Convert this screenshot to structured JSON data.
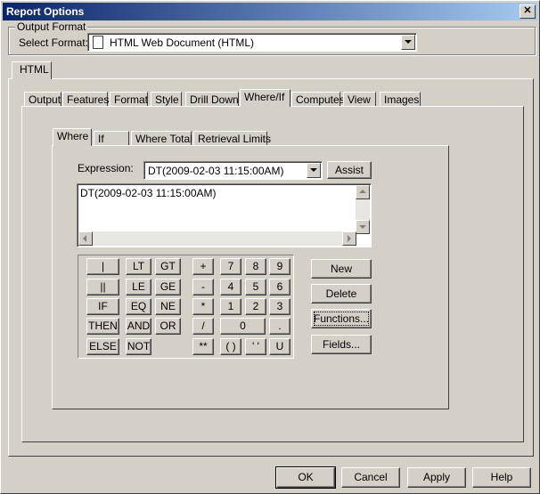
{
  "window": {
    "title": "Report Options",
    "close_glyph": "✕"
  },
  "output_format": {
    "group_label": "Output Format",
    "select_label": "Select Format:",
    "selected": "HTML Web Document (HTML)",
    "icon": "document-icon"
  },
  "outer_tab": "HTML",
  "tabs": [
    "Output",
    "Features",
    "Format",
    "Style",
    "Drill Down",
    "Where/If",
    "Computes",
    "View",
    "Images"
  ],
  "selected_tab": "Where/If",
  "subtabs": [
    "Where",
    "If",
    "Where Total",
    "Retrieval Limits"
  ],
  "selected_subtab": "Where",
  "expression": {
    "label": "Expression:",
    "combo_value": "DT(2009-02-03 11:15:00AM)",
    "assist_label": "Assist",
    "text": "DT(2009-02-03 11:15:00AM)"
  },
  "keys": {
    "k_or": "|",
    "k_concat": "||",
    "k_if": "IF",
    "k_then": "THEN",
    "k_else": "ELSE",
    "k_lt": "LT",
    "k_gt": "GT",
    "k_le": "LE",
    "k_ge": "GE",
    "k_eq": "EQ",
    "k_ne": "NE",
    "k_and": "AND",
    "k_or2": "OR",
    "k_not": "NOT",
    "k_plus": "+",
    "k_minus": "-",
    "k_mul": "*",
    "k_div": "/",
    "k_pow": "**",
    "k7": "7",
    "k8": "8",
    "k9": "9",
    "k4": "4",
    "k5": "5",
    "k6": "6",
    "k1": "1",
    "k2": "2",
    "k3": "3",
    "k0": "0",
    "k_dot": ".",
    "k_paren": "( )",
    "k_quote": "' '",
    "k_u": "U"
  },
  "side_buttons": {
    "new": "New",
    "delete": "Delete",
    "functions": "Functions...",
    "fields": "Fields..."
  },
  "footer": {
    "ok": "OK",
    "cancel": "Cancel",
    "apply": "Apply",
    "help": "Help"
  }
}
